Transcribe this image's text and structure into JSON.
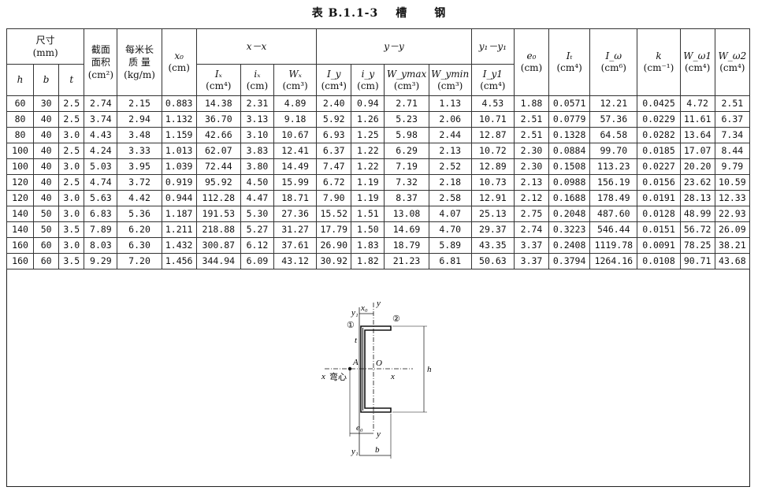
{
  "title": {
    "code": "表 B.1.1-3",
    "w1": "槽",
    "w2": "钢"
  },
  "header": {
    "size_group": "尺寸",
    "size_unit": "(mm)",
    "h": "h",
    "b": "b",
    "t": "t",
    "area": "截面面积",
    "area_unit": "(cm²)",
    "mass": "每米长质 量",
    "mass_unit": "(kg/m)",
    "x0": "x₀",
    "x0_unit": "(cm)",
    "xx": "x－x",
    "yy": "y－y",
    "y1y1": "y₁－y₁",
    "Ix": "Iₓ",
    "ix": "iₓ",
    "Wx": "Wₓ",
    "Iy": "I_y",
    "iy": "i_y",
    "Wymax": "W_ymax",
    "Wymin": "W_ymin",
    "Iy1": "I_y1",
    "e0": "e₀",
    "It": "Iₜ",
    "Iw": "I_ω",
    "k": "k",
    "Ww1": "W_ω1",
    "Ww2": "W_ω2",
    "u_cm4": "(cm⁴)",
    "u_cm": "(cm)",
    "u_cm3": "(cm³)",
    "u_cm6": "(cm⁶)",
    "u_cm_1": "(cm⁻¹)"
  },
  "rows": [
    [
      "60",
      "30",
      "2.5",
      "2.74",
      "2.15",
      "0.883",
      "14.38",
      "2.31",
      "4.89",
      "2.40",
      "0.94",
      "2.71",
      "1.13",
      "4.53",
      "1.88",
      "0.0571",
      "12.21",
      "0.0425",
      "4.72",
      "2.51"
    ],
    [
      "80",
      "40",
      "2.5",
      "3.74",
      "2.94",
      "1.132",
      "36.70",
      "3.13",
      "9.18",
      "5.92",
      "1.26",
      "5.23",
      "2.06",
      "10.71",
      "2.51",
      "0.0779",
      "57.36",
      "0.0229",
      "11.61",
      "6.37"
    ],
    [
      "80",
      "40",
      "3.0",
      "4.43",
      "3.48",
      "1.159",
      "42.66",
      "3.10",
      "10.67",
      "6.93",
      "1.25",
      "5.98",
      "2.44",
      "12.87",
      "2.51",
      "0.1328",
      "64.58",
      "0.0282",
      "13.64",
      "7.34"
    ],
    [
      "100",
      "40",
      "2.5",
      "4.24",
      "3.33",
      "1.013",
      "62.07",
      "3.83",
      "12.41",
      "6.37",
      "1.22",
      "6.29",
      "2.13",
      "10.72",
      "2.30",
      "0.0884",
      "99.70",
      "0.0185",
      "17.07",
      "8.44"
    ],
    [
      "100",
      "40",
      "3.0",
      "5.03",
      "3.95",
      "1.039",
      "72.44",
      "3.80",
      "14.49",
      "7.47",
      "1.22",
      "7.19",
      "2.52",
      "12.89",
      "2.30",
      "0.1508",
      "113.23",
      "0.0227",
      "20.20",
      "9.79"
    ],
    [
      "120",
      "40",
      "2.5",
      "4.74",
      "3.72",
      "0.919",
      "95.92",
      "4.50",
      "15.99",
      "6.72",
      "1.19",
      "7.32",
      "2.18",
      "10.73",
      "2.13",
      "0.0988",
      "156.19",
      "0.0156",
      "23.62",
      "10.59"
    ],
    [
      "120",
      "40",
      "3.0",
      "5.63",
      "4.42",
      "0.944",
      "112.28",
      "4.47",
      "18.71",
      "7.90",
      "1.19",
      "8.37",
      "2.58",
      "12.91",
      "2.12",
      "0.1688",
      "178.49",
      "0.0191",
      "28.13",
      "12.33"
    ],
    [
      "140",
      "50",
      "3.0",
      "6.83",
      "5.36",
      "1.187",
      "191.53",
      "5.30",
      "27.36",
      "15.52",
      "1.51",
      "13.08",
      "4.07",
      "25.13",
      "2.75",
      "0.2048",
      "487.60",
      "0.0128",
      "48.99",
      "22.93"
    ],
    [
      "140",
      "50",
      "3.5",
      "7.89",
      "6.20",
      "1.211",
      "218.88",
      "5.27",
      "31.27",
      "17.79",
      "1.50",
      "14.69",
      "4.70",
      "29.37",
      "2.74",
      "0.3223",
      "546.44",
      "0.0151",
      "56.72",
      "26.09"
    ],
    [
      "160",
      "60",
      "3.0",
      "8.03",
      "6.30",
      "1.432",
      "300.87",
      "6.12",
      "37.61",
      "26.90",
      "1.83",
      "18.79",
      "5.89",
      "43.35",
      "3.37",
      "0.2408",
      "1119.78",
      "0.0091",
      "78.25",
      "38.21"
    ],
    [
      "160",
      "60",
      "3.5",
      "9.29",
      "7.20",
      "1.456",
      "344.94",
      "6.09",
      "43.12",
      "30.92",
      "1.82",
      "21.23",
      "6.81",
      "50.63",
      "3.37",
      "0.3794",
      "1264.16",
      "0.0108",
      "90.71",
      "43.68"
    ]
  ],
  "diagram": {
    "y1_top": "y₁",
    "x0": "x₀",
    "y_top": "y",
    "c1": "①",
    "c2": "②",
    "t": "t",
    "A": "A",
    "O": "O",
    "x_left": "x",
    "shear": "弯心",
    "x_right": "x",
    "h": "h",
    "e0": "e₀",
    "y_bot": "y",
    "y1_bot": "y₁",
    "b": "b"
  }
}
